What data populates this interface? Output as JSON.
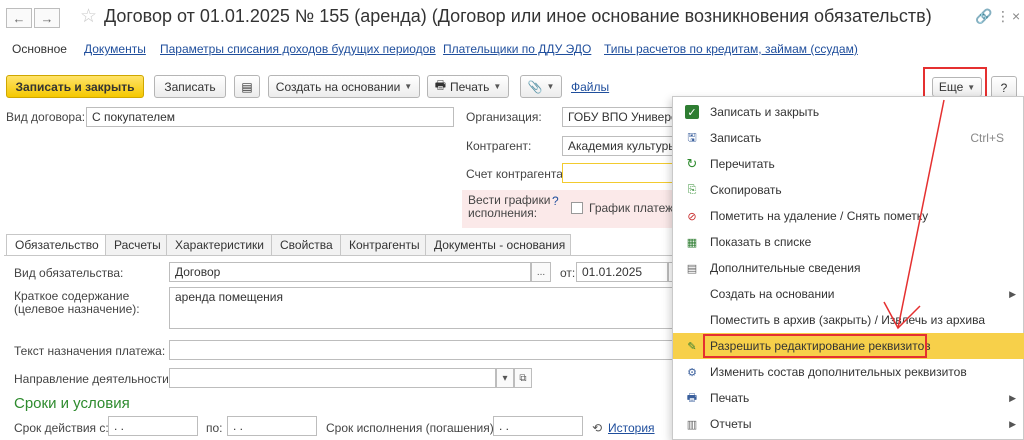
{
  "window": {
    "back_icon": "arrow-left-icon",
    "forward_icon": "arrow-right-icon",
    "title": "Договор от 01.01.2025 № 155 (аренда) (Договор или иное основание возникновения обязательств)",
    "link_icon": "link-icon",
    "more_icon": "kebab-icon",
    "close_icon": "close-icon"
  },
  "nav_tabs": [
    "Основное",
    "Документы",
    "Параметры списания доходов будущих периодов",
    "Плательщики по ДДУ ЭДО",
    "Типы расчетов по кредитам, займам (ссудам)"
  ],
  "toolbar": {
    "save_close": "Записать и закрыть",
    "save": "Записать",
    "create_based": "Создать на основании",
    "print": "Печать",
    "files": "Файлы",
    "more": "Еще",
    "help": "?"
  },
  "form": {
    "contract_type_label": "Вид договора:",
    "contract_type_value": "С покупателем",
    "org_label": "Организация:",
    "org_value": "ГОБУ ВПО Универс",
    "counterparty_label": "Контрагент:",
    "counterparty_value": "Академия культуры",
    "account_label": "Счет контрагента:",
    "account_value": "",
    "schedules_label": "Вести графики исполнения:",
    "schedules_help": "?",
    "schedule_checkbox_label": "График платеже"
  },
  "inner_tabs": [
    "Обязательство",
    "Расчеты",
    "Характеристики",
    "Свойства",
    "Контрагенты",
    "Документы - основания"
  ],
  "obligation": {
    "type_label": "Вид обязательства:",
    "type_value": "Договор",
    "ellipsis": "...",
    "from_label": "от:",
    "from_value": "01.01.2025",
    "summary_label": "Краткое содержание (целевое назначение):",
    "summary_value": "аренда помещения",
    "payment_label": "Текст назначения платежа:",
    "payment_value": "",
    "direction_label": "Направление деятельности:",
    "direction_value": "",
    "terms_heading": "Сроки и условия",
    "valid_from_label": "Срок действия с:",
    "valid_from_value": ". .",
    "to_label": "по:",
    "to_value": ". .",
    "deadline_label": "Срок исполнения (погашения):",
    "deadline_value": ". .",
    "history_link": "История"
  },
  "menu": {
    "items": [
      {
        "icon": "check-icon",
        "label": "Записать и закрыть",
        "shortcut": "",
        "submenu": false
      },
      {
        "icon": "disk-icon",
        "label": "Записать",
        "shortcut": "Ctrl+S",
        "submenu": false
      },
      {
        "icon": "refresh-icon",
        "label": "Перечитать",
        "shortcut": "",
        "submenu": false
      },
      {
        "icon": "copy-icon",
        "label": "Скопировать",
        "shortcut": "",
        "submenu": false
      },
      {
        "icon": "delete-mark-icon",
        "label": "Пометить на удаление / Снять пометку",
        "shortcut": "",
        "submenu": false
      },
      {
        "icon": "list-icon",
        "label": "Показать в списке",
        "shortcut": "",
        "submenu": false
      },
      {
        "icon": "details-icon",
        "label": "Дополнительные сведения",
        "shortcut": "",
        "submenu": false
      },
      {
        "icon": "",
        "label": "Создать на основании",
        "shortcut": "",
        "submenu": true
      },
      {
        "icon": "",
        "label": "Поместить в архив (закрыть) / Извлечь из архива",
        "shortcut": "",
        "submenu": false
      },
      {
        "icon": "edit-icon",
        "label": "Разрешить редактирование реквизитов",
        "shortcut": "",
        "submenu": false,
        "highlighted": true
      },
      {
        "icon": "attributes-icon",
        "label": "Изменить состав дополнительных реквизитов",
        "shortcut": "",
        "submenu": false
      },
      {
        "icon": "printer-icon",
        "label": "Печать",
        "shortcut": "",
        "submenu": true
      },
      {
        "icon": "reports-icon",
        "label": "Отчеты",
        "shortcut": "",
        "submenu": true
      }
    ]
  },
  "colors": {
    "accent_yellow": "#f5c800",
    "highlight": "#f7d04a",
    "annotation_red": "#e53030",
    "link_blue": "#1f4e9c",
    "green_heading": "#2e8b2e"
  }
}
